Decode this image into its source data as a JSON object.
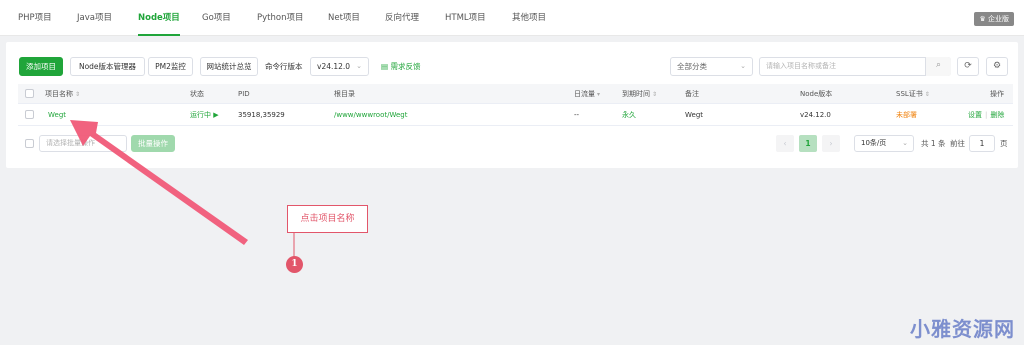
{
  "tabs": [
    "PHP项目",
    "Java项目",
    "Node项目",
    "Go项目",
    "Python项目",
    "Net项目",
    "反向代理",
    "HTML项目",
    "其他项目"
  ],
  "enterprise_badge": "企业版",
  "toolbar": {
    "add_project": "添加项目",
    "node_version_manager": "Node版本管理器",
    "pm2_monitor": "PM2监控",
    "site_stats": "网站统计总览",
    "cmd_version_label": "命令行版本",
    "cmd_version_value": "v24.12.0",
    "feedback": "需求反馈",
    "category_select": "全部分类",
    "search_placeholder": "请输入项目名称或备注"
  },
  "table": {
    "headers": {
      "name": "项目名称",
      "status": "状态",
      "pid": "PID",
      "root": "根目录",
      "traffic": "日流量",
      "expire": "到期时间",
      "remark": "备注",
      "node_version": "Node版本",
      "ssl": "SSL证书",
      "actions": "操作"
    },
    "rows": [
      {
        "name": "Wegt",
        "status": "运行中",
        "pid": "35918,35929",
        "root": "/www/wwwroot/Wegt",
        "traffic": "--",
        "expire": "永久",
        "remark": "Wegt",
        "node_version": "v24.12.0",
        "ssl": "未部署",
        "action_settings": "设置",
        "action_delete": "删除"
      }
    ]
  },
  "footer": {
    "batch_select_placeholder": "请选择批量操作",
    "batch_button": "批量操作",
    "prev": "‹",
    "current_page": "1",
    "next": "›",
    "page_size": "10条/页",
    "total": "共 1 条",
    "goto_label": "前往",
    "goto_value": "1",
    "page_suffix": "页"
  },
  "annotation": {
    "callout": "点击项目名称",
    "marker": "1"
  },
  "watermark": "小雅资源网",
  "colors": {
    "accent": "#20a53a",
    "annotation": "#e2566a",
    "warning": "#f0830f"
  }
}
